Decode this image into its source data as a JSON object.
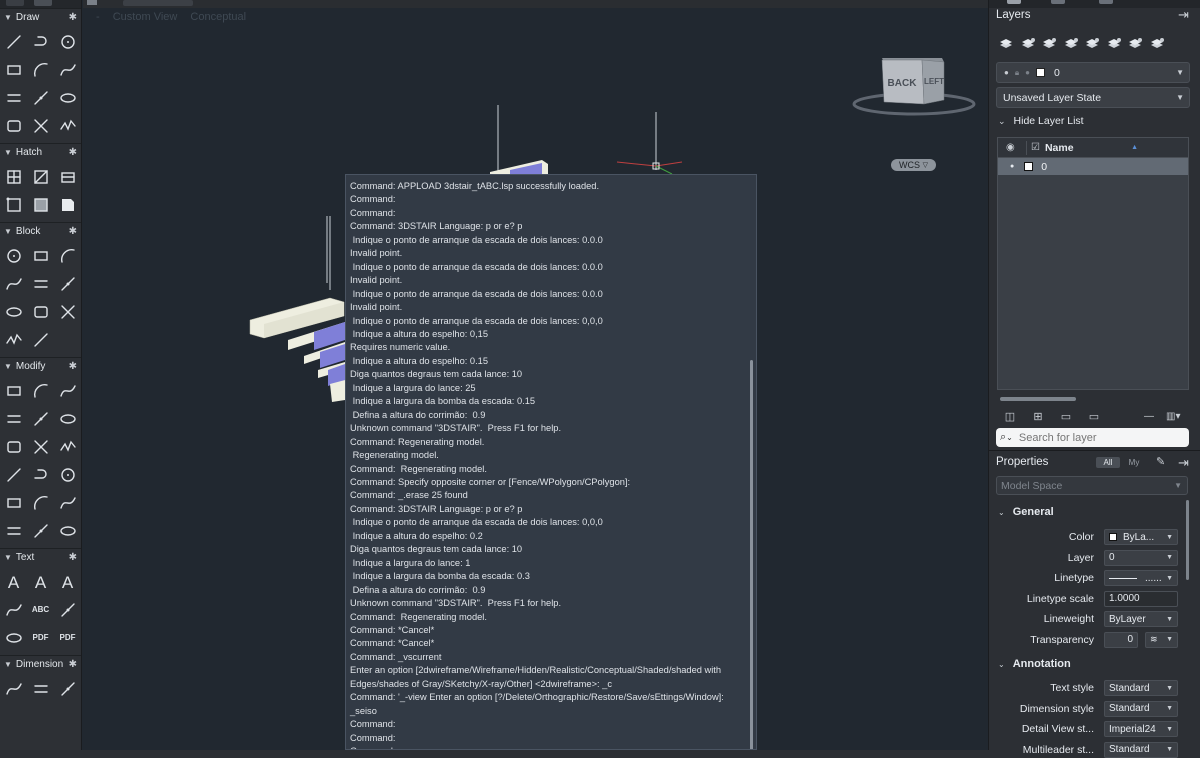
{
  "viewport": {
    "view_label": "Custom View",
    "visual_style_label": "Conceptual",
    "minus": "-",
    "wcs_label": "WCS"
  },
  "viewcube": {
    "back_label": "BACK",
    "left_label": "LEFT"
  },
  "palette": {
    "sections": [
      {
        "title": "Draw",
        "tools": [
          "line-icon",
          "polyline-icon",
          "circle-icon",
          "rectangle-icon",
          "arc-icon",
          "spline-icon",
          "multiline-icon",
          "construction-line-icon",
          "ellipse-icon",
          "region-icon",
          "trim-icon",
          "revcloud-icon"
        ]
      },
      {
        "title": "Hatch",
        "tools": [
          "hatch-icon",
          "gradient-icon",
          "boundary-icon",
          "wipeout-icon",
          "table-icon",
          "block-attribute-icon"
        ]
      },
      {
        "title": "Block",
        "tools": [
          "insert-block-icon",
          "create-block-icon",
          "edit-block-icon",
          "attribute-icon",
          "tag-icon",
          "block-editor-icon",
          "write-block-icon",
          "clip-icon",
          "tool-palette-icon",
          "match-icon",
          "base-point-icon"
        ]
      },
      {
        "title": "Modify",
        "tools": [
          "move-icon",
          "copy-icon",
          "mirror-icon",
          "rotate-icon",
          "stretch-icon",
          "trim-tool-icon",
          "fillet-icon",
          "offset-icon",
          "array-icon",
          "3d-move-icon",
          "scale-icon",
          "erase-icon",
          "explode-icon",
          "break-icon",
          "join-icon",
          "align-icon",
          "match-prop-icon",
          "purge-icon"
        ]
      },
      {
        "title": "Text",
        "tools": [
          "multiline-text-icon",
          "single-line-text-icon",
          "text-style-icon",
          "spell-check-icon",
          "find-icon",
          "text-mask-icon",
          "frame-icon",
          "pdf-import-icon",
          "pdf-text-icon"
        ]
      },
      {
        "title": "Dimension",
        "tools": [
          "linear-dim-icon",
          "aligned-dim-icon",
          "continue-dim-icon"
        ]
      }
    ],
    "text_glyphs": {
      "spell": "ABC",
      "pdf": "PDF"
    }
  },
  "command_history": [
    "Command: APPLOAD 3dstair_tABC.lsp successfully loaded.",
    "Command:",
    "Command:",
    "Command: 3DSTAIR Language: p or e? p",
    " Indique o ponto de arranque da escada de dois lances: 0.0.0",
    "Invalid point.",
    " Indique o ponto de arranque da escada de dois lances: 0.0.0",
    "Invalid point.",
    " Indique o ponto de arranque da escada de dois lances: 0.0.0",
    "Invalid point.",
    " Indique o ponto de arranque da escada de dois lances: 0,0,0",
    " Indique a altura do espelho: 0,15",
    "Requires numeric value.",
    " Indique a altura do espelho: 0.15",
    "Diga quantos degraus tem cada lance: 10",
    " Indique a largura do lance: 25",
    " Indique a largura da bomba da escada: 0.15",
    " Defina a altura do corrimão:  0.9",
    "Unknown command \"3DSTAIR\".  Press F1 for help.",
    "Command: Regenerating model.",
    " Regenerating model.",
    "Command:  Regenerating model.",
    "Command: Specify opposite corner or [Fence/WPolygon/CPolygon]:",
    "Command: _.erase 25 found",
    "Command: 3DSTAIR Language: p or e? p",
    " Indique o ponto de arranque da escada de dois lances: 0,0,0",
    " Indique a altura do espelho: 0.2",
    "Diga quantos degraus tem cada lance: 10",
    " Indique a largura do lance: 1",
    " Indique a largura da bomba da escada: 0.3",
    " Defina a altura do corrimão:  0.9",
    "Unknown command \"3DSTAIR\".  Press F1 for help.",
    "Command:  Regenerating model.",
    "Command: *Cancel*",
    "Command: *Cancel*",
    "Command: _vscurrent",
    "Enter an option [2dwireframe/Wireframe/Hidden/Realistic/Conceptual/Shaded/shaded with",
    "Edges/shades of Gray/SKetchy/X-ray/Other] <2dwireframe>: _c",
    "Command: '_-view Enter an option [?/Delete/Orthographic/Restore/Save/sEttings/Window]:",
    "_seiso",
    "Command:",
    "Command:",
    "Command:"
  ],
  "layers": {
    "title": "Layers",
    "current_layer": "0",
    "layer_state": "Unsaved Layer State",
    "hide_list_label": "Hide Layer List",
    "column_name": "Name",
    "rows": [
      {
        "name": "0"
      }
    ],
    "search_placeholder": "Search for layer"
  },
  "properties": {
    "title": "Properties",
    "filter_all": "All",
    "filter_my": "My",
    "space": "Model Space",
    "general_title": "General",
    "general": [
      {
        "label": "Color",
        "value": "ByLa..."
      },
      {
        "label": "Layer",
        "value": "0"
      },
      {
        "label": "Linetype",
        "value": "......"
      },
      {
        "label": "Linetype scale",
        "value": "1.0000"
      },
      {
        "label": "Lineweight",
        "value": "ByLayer"
      },
      {
        "label": "Transparency",
        "value": "0"
      }
    ],
    "annotation_title": "Annotation",
    "annotation": [
      {
        "label": "Text style",
        "value": "Standard"
      },
      {
        "label": "Dimension style",
        "value": "Standard"
      },
      {
        "label": "Detail View st...",
        "value": "Imperial24"
      },
      {
        "label": "Multileader st...",
        "value": "Standard"
      }
    ]
  },
  "colors": {
    "canvas": "#212830",
    "command_bg": "#323a45",
    "stair_tread": "#eeeee0",
    "stair_riser": "#7f7fd8",
    "layer_row_selected": "#626a74"
  }
}
